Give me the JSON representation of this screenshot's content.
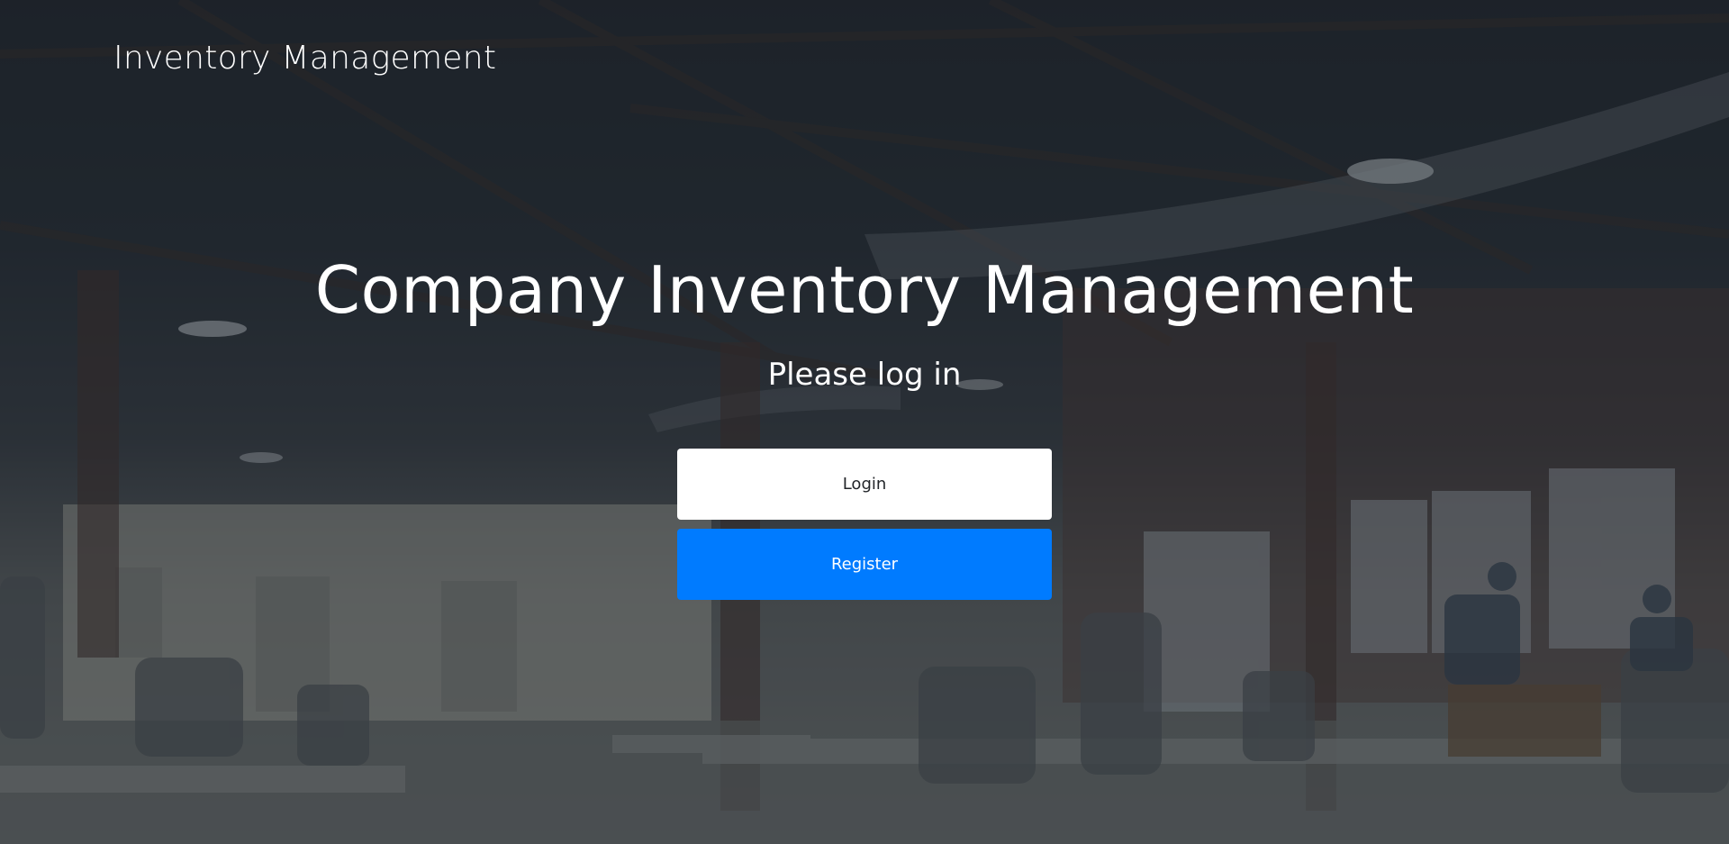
{
  "navbar": {
    "brand": "Inventory Management"
  },
  "hero": {
    "title": "Company Inventory Management",
    "subtitle": "Please log in"
  },
  "actions": {
    "login_label": "Login",
    "register_label": "Register"
  },
  "colors": {
    "primary": "#007bff",
    "login_bg": "#ffffff",
    "text_on_dark": "#ffffff"
  }
}
